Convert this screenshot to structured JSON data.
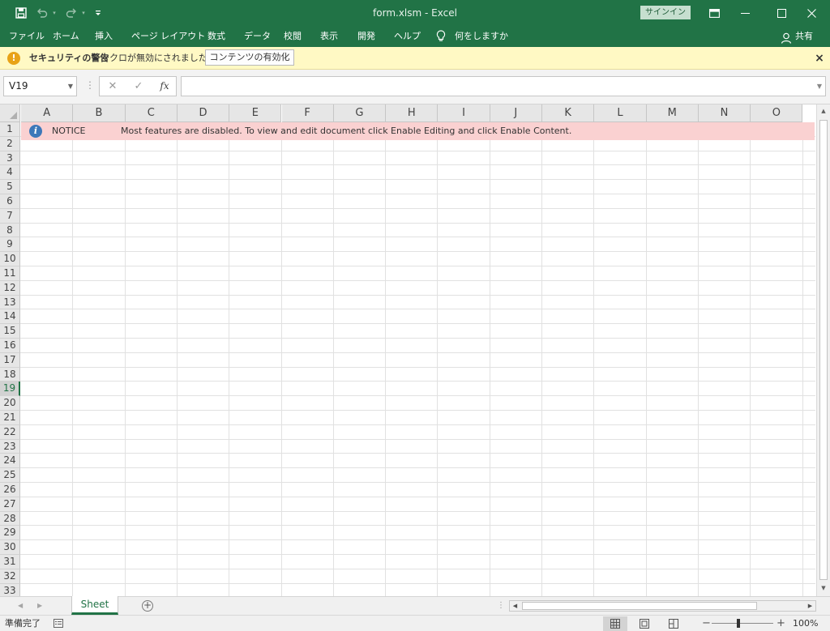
{
  "window": {
    "title": "form.xlsm  -  Excel",
    "signin_label": "サインイン"
  },
  "ribbon": {
    "tabs": [
      "ファイル",
      "ホーム",
      "挿入",
      "ページ レイアウト",
      "数式",
      "データ",
      "校閲",
      "表示",
      "開発",
      "ヘルプ"
    ],
    "tell_me": "何をしますか",
    "share_label": "共有"
  },
  "security_bar": {
    "title": "セキュリティの警告",
    "message": "マクロが無効にされました。",
    "button_label": "コンテンツの有効化",
    "close_glyph": "×"
  },
  "formula_bar": {
    "name_box": "V19",
    "cancel_glyph": "✕",
    "enter_glyph": "✓",
    "fx_label": "fx",
    "formula_value": ""
  },
  "grid": {
    "columns": [
      "A",
      "B",
      "C",
      "D",
      "E",
      "F",
      "G",
      "H",
      "I",
      "J",
      "K",
      "L",
      "M",
      "N",
      "O"
    ],
    "rows": [
      "1",
      "2",
      "3",
      "4",
      "5",
      "6",
      "7",
      "8",
      "9",
      "10",
      "11",
      "12",
      "13",
      "14",
      "15",
      "16",
      "17",
      "18",
      "19",
      "20",
      "21",
      "22",
      "23",
      "24",
      "25",
      "26",
      "27",
      "28",
      "29",
      "30",
      "31",
      "32",
      "33"
    ],
    "active_row": "19",
    "notice": {
      "label": "NOTICE",
      "message": "Most features are disabled. To view and edit document click Enable Editing and click Enable Content."
    },
    "colors": {
      "notice_band": "#fad1d1",
      "notice_icon": "#3d78b9",
      "accent": "#217346"
    }
  },
  "sheet_tabs": {
    "tabs": [
      "Sheet"
    ],
    "active": "Sheet"
  },
  "status_bar": {
    "status": "準備完了",
    "zoom_minus": "−",
    "zoom_plus": "+",
    "zoom": "100%"
  }
}
